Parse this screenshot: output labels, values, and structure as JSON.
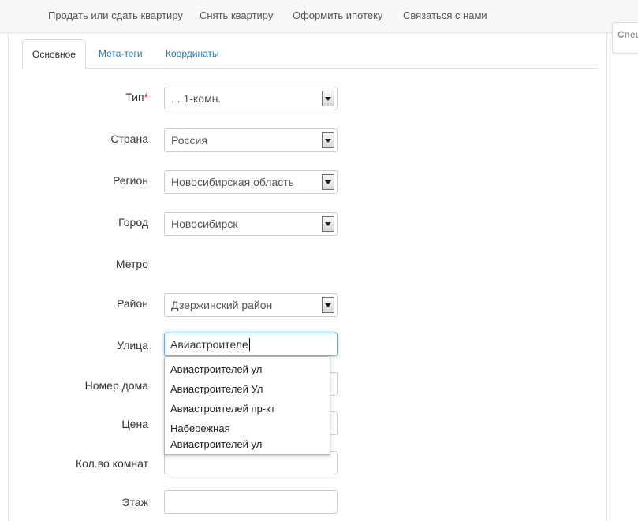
{
  "topnav": {
    "items": [
      "Продать или сдать квартиру",
      "Снять квартиру",
      "Оформить ипотеку",
      "Связаться с нами"
    ]
  },
  "side_card": {
    "label": "Спец"
  },
  "tabs": [
    {
      "label": "Основное",
      "active": true
    },
    {
      "label": "Мета-теги",
      "active": false
    },
    {
      "label": "Координаты",
      "active": false
    }
  ],
  "form": {
    "type": {
      "label": "Тип",
      "required_mark": "*",
      "value": ". . 1-комн."
    },
    "country": {
      "label": "Страна",
      "value": "Россия"
    },
    "region": {
      "label": "Регион",
      "value": "Новосибирская область"
    },
    "city": {
      "label": "Город",
      "value": "Новосибирск"
    },
    "metro": {
      "label": "Метро"
    },
    "district": {
      "label": "Район",
      "value": "Дзержинский район"
    },
    "street": {
      "label": "Улица",
      "value": "Авиастроителе"
    },
    "house": {
      "label": "Номер дома",
      "value": ""
    },
    "price": {
      "label": "Цена",
      "value": ""
    },
    "rooms": {
      "label": "Кол.во комнат",
      "value": ""
    },
    "floor": {
      "label": "Этаж",
      "value": ""
    }
  },
  "autocomplete": {
    "items": [
      "Авиастроителей ул",
      "Авиастроителей Ул",
      "Авиастроителей пр-кт",
      "Набережная",
      "Авиастроителей ул"
    ]
  },
  "colors": {
    "link": "#2a7ab8",
    "required": "#cc0000",
    "focus": "#66afe9"
  }
}
